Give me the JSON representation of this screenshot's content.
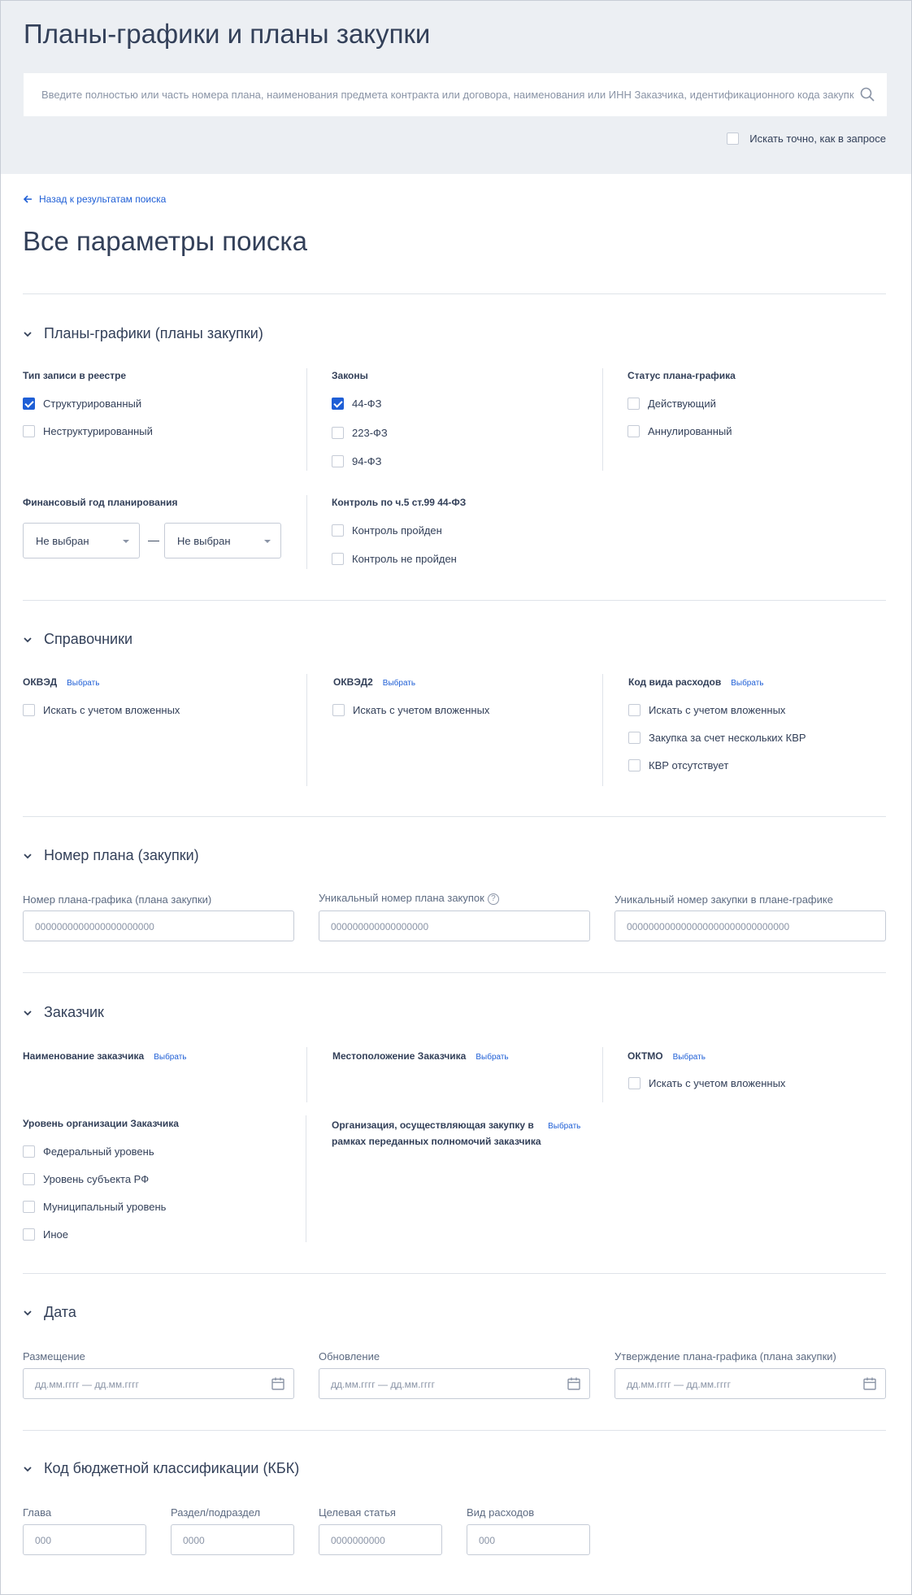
{
  "header": {
    "title": "Планы-графики и планы закупки",
    "search_placeholder": "Введите полностью или часть номера плана, наименования предмета контракта или договора, наименования или ИНН Заказчика, идентификационного кода закупки (",
    "exact_label": "Искать точно, как в запросе"
  },
  "back_link": "Назад к результатам поиска",
  "page_heading": "Все параметры поиска",
  "sections": {
    "plans": {
      "title": "Планы-графики (планы закупки)",
      "record_type": {
        "label": "Тип записи в реестре",
        "options": [
          "Структурированный",
          "Неструктурированный"
        ],
        "checked": [
          true,
          false
        ]
      },
      "laws": {
        "label": "Законы",
        "options": [
          "44-ФЗ",
          "223-ФЗ",
          "94-ФЗ"
        ],
        "checked": [
          true,
          false,
          false
        ]
      },
      "status": {
        "label": "Статус плана-графика",
        "options": [
          "Действующий",
          "Аннулированный"
        ],
        "checked": [
          false,
          false
        ]
      },
      "fin_year": {
        "label": "Финансовый год планирования",
        "from": "Не выбран",
        "to": "Не выбран",
        "separator": "—"
      },
      "control": {
        "label": "Контроль по ч.5 ст.99 44-ФЗ",
        "options": [
          "Контроль пройден",
          "Контроль не пройден"
        ],
        "checked": [
          false,
          false
        ]
      }
    },
    "directories": {
      "title": "Справочники",
      "okved": {
        "label": "ОКВЭД",
        "pick": "Выбрать",
        "option": "Искать с учетом вложенных"
      },
      "okved2": {
        "label": "ОКВЭД2",
        "pick": "Выбрать",
        "option": "Искать с учетом вложенных"
      },
      "kvr": {
        "label": "Код вида расходов",
        "pick": "Выбрать",
        "options": [
          "Искать с учетом вложенных",
          "Закупка за счет нескольких КВР",
          "КВР отсутствует"
        ]
      }
    },
    "plan_number": {
      "title": "Номер плана (закупки)",
      "fields": [
        {
          "label": "Номер плана-графика (плана закупки)",
          "placeholder": "0000000000000000000000"
        },
        {
          "label": "Уникальный номер плана закупок",
          "placeholder": "000000000000000000"
        },
        {
          "label": "Уникальный номер закупки в плане-графике",
          "placeholder": "000000000000000000000000000000"
        }
      ],
      "help_glyph": "?"
    },
    "customer": {
      "title": "Заказчик",
      "name": {
        "label": "Наименование заказчика",
        "pick": "Выбрать"
      },
      "location": {
        "label": "Местоположение Заказчика",
        "pick": "Выбрать"
      },
      "oktmo": {
        "label": "ОКТМО",
        "pick": "Выбрать",
        "option": "Искать с учетом вложенных"
      },
      "level": {
        "label": "Уровень организации Заказчика",
        "options": [
          "Федеральный уровень",
          "Уровень субъекта РФ",
          "Муниципальный уровень",
          "Иное"
        ]
      },
      "org": {
        "label_line1": "Организация, осуществляющая закупку в",
        "label_line2": "рамках переданных полномочий заказчика",
        "pick": "Выбрать"
      }
    },
    "date": {
      "title": "Дата",
      "fields": [
        {
          "label": "Размещение",
          "placeholder": "дд.мм.гггг — дд.мм.гггг"
        },
        {
          "label": "Обновление",
          "placeholder": "дд.мм.гггг — дд.мм.гггг"
        },
        {
          "label": "Утверждение плана-графика (плана закупки)",
          "placeholder": "дд.мм.гггг — дд.мм.гггг"
        }
      ]
    },
    "kbk": {
      "title": "Код бюджетной классификации (КБК)",
      "fields": [
        {
          "label": "Глава",
          "placeholder": "000"
        },
        {
          "label": "Раздел/подраздел",
          "placeholder": "0000"
        },
        {
          "label": "Целевая статья",
          "placeholder": "0000000000"
        },
        {
          "label": "Вид расходов",
          "placeholder": "000"
        }
      ]
    }
  },
  "colors": {
    "accent": "#1f5fd6",
    "text": "#334059",
    "header_bg": "#eceff3",
    "border": "#c5cbd6"
  }
}
